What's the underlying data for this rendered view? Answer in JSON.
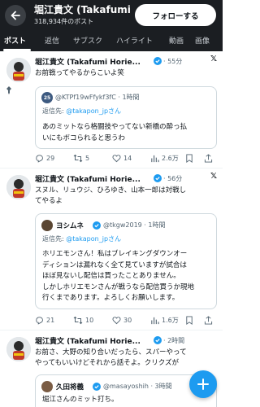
{
  "header": {
    "title": "堀江貴文 (Takafumi Ho",
    "post_count": "318,934件のポスト",
    "follow_label": "フォローする"
  },
  "tabs": [
    "ポスト",
    "返信",
    "サブスク",
    "ハイライト",
    "動画",
    "画像"
  ],
  "active_tab": "ポスト",
  "tweets": [
    {
      "name": "堀江貴文 (Takafumi Horie...",
      "time": "· 55分",
      "text": [
        "お前戦ってやるからこいよ笑"
      ],
      "quote": {
        "avatar_text": "25",
        "name": "",
        "handle": "@KTPf19wFfykf3fC · 1時間",
        "reply_prefix": "返信先: ",
        "reply_mention": "@takapon_jpさん",
        "text": [
          "あのミットなら格闘技やってない新橋の酔っ払",
          "いにもボコられると思うわ"
        ]
      },
      "stats": {
        "replies": "29",
        "retweets": "5",
        "likes": "14",
        "views": "2.6万"
      }
    },
    {
      "name": "堀江貴文 (Takafumi Horie...",
      "time": "· 56分",
      "text": [
        "スヌル、リュウジ、ひろゆき、山本一郎は対戦し",
        "てやるよ"
      ],
      "quote": {
        "avatar_text": "",
        "name": "ヨシムネ",
        "handle": "@tkgw2019 · 1時間",
        "reply_prefix": "返信先: ",
        "reply_mention": "@takapon_jpさん",
        "text": [
          "ホリエモンさん！私はブレイキングダウンオー",
          "ディションは漏れなく全て見ていますが試合は",
          "ほぼ見ないし配信は買ったことありません。",
          "しかしホリエモンさんが戦うなら配信買うか現地",
          "行くまであります。よろしくお願いします。"
        ]
      },
      "stats": {
        "replies": "21",
        "retweets": "10",
        "likes": "30",
        "views": "1.6万"
      }
    },
    {
      "name": "堀江貴文 (Takafumi Horie...",
      "time": "· 2時間",
      "text": [
        "お前さ、大野の知り合いだったら、スパーやって",
        "やってもいいけどそれから話そよ。クリクズが"
      ],
      "quote": {
        "avatar_text": "",
        "name": "久田将義",
        "handle": "@masayoshih · 3時間",
        "reply_prefix": "",
        "reply_mention": "",
        "text": [
          "堀江さんのミット打ち。"
        ]
      },
      "stats": {
        "replies": "",
        "retweets": "",
        "likes": "",
        "views": ""
      }
    }
  ],
  "colors": {
    "accent": "#1d9bf0",
    "header_bg": "#1b1e22",
    "muted": "#536471"
  }
}
